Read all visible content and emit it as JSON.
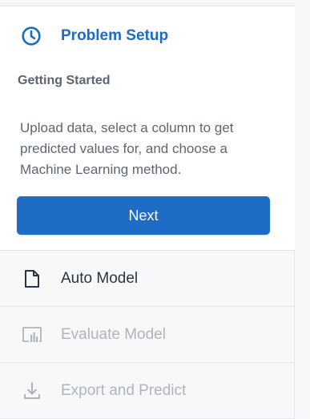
{
  "active_step": {
    "title": "Problem Setup",
    "icon": "clock-icon",
    "subtitle": "Getting Started",
    "description": "Upload data, select a column to get predicted values for, and choose a Machine Learning method.",
    "next_label": "Next"
  },
  "steps": [
    {
      "label": "Auto Model",
      "icon": "document-icon",
      "state": "enabled"
    },
    {
      "label": "Evaluate Model",
      "icon": "chart-icon",
      "state": "disabled"
    },
    {
      "label": "Export and Predict",
      "icon": "download-icon",
      "state": "disabled"
    }
  ],
  "colors": {
    "accent": "#1a6cc4",
    "button": "#1f6cc7",
    "disabled": "#b0b5bb"
  }
}
